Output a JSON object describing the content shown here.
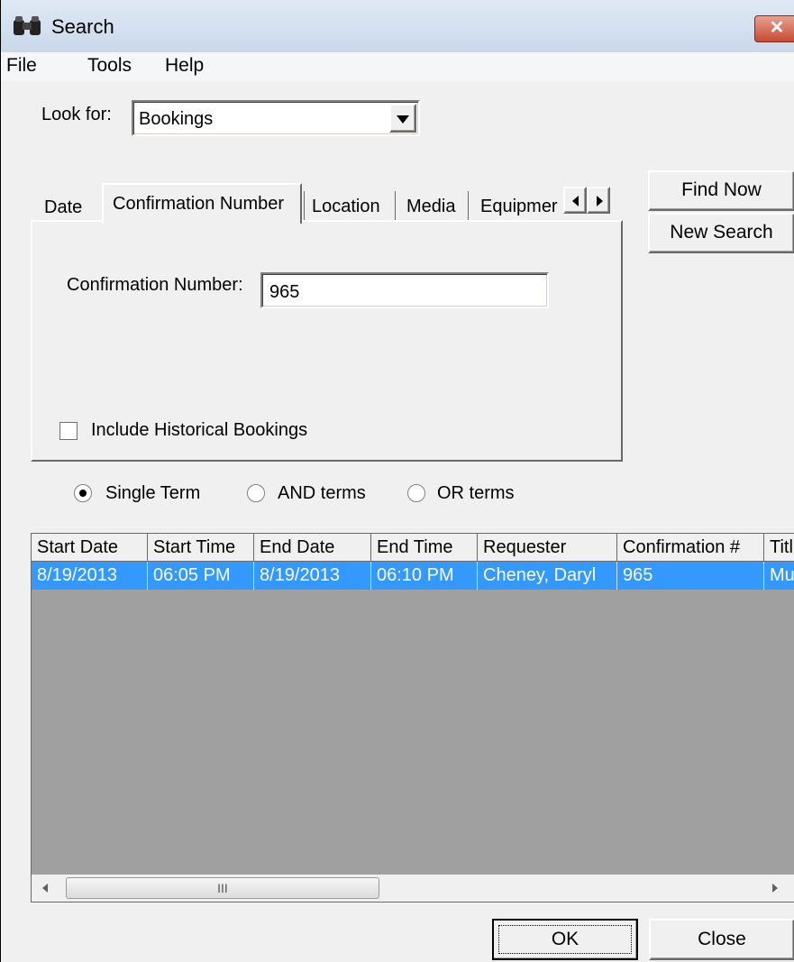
{
  "window": {
    "title": "Search",
    "close_label": "✕"
  },
  "menu": {
    "items": [
      "File",
      "Tools",
      "Help"
    ]
  },
  "look_for": {
    "label": "Look for:",
    "value": "Bookings"
  },
  "tabs": {
    "items": [
      "Date",
      "Confirmation Number",
      "Location",
      "Media",
      "Equipmer"
    ],
    "active": "Confirmation Number"
  },
  "buttons": {
    "find_now": "Find Now",
    "new_search": "New Search",
    "ok": "OK",
    "close": "Close"
  },
  "panel": {
    "field_label": "Confirmation Number:",
    "field_value": "965",
    "checkbox_label": "Include Historical Bookings",
    "checkbox_checked": false
  },
  "search_mode": {
    "options": [
      "Single Term",
      "AND terms",
      "OR terms"
    ],
    "selected": "Single Term"
  },
  "results": {
    "columns": [
      "Start Date",
      "Start Time",
      "End Date",
      "End Time",
      "Requester",
      "Confirmation #",
      "Titl"
    ],
    "rows": [
      [
        "8/19/2013",
        "06:05 PM",
        "8/19/2013",
        "06:10 PM",
        "Cheney, Daryl",
        "965",
        "Mu"
      ]
    ],
    "scroll_thumb": "III"
  },
  "colors": {
    "selection": "#3399ff",
    "grid_background": "#a0a0a0"
  }
}
